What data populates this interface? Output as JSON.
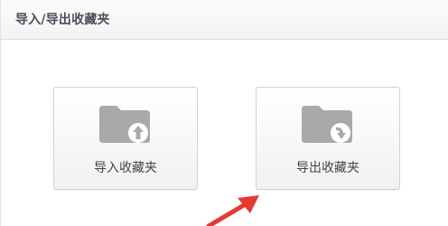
{
  "dialog": {
    "title": "导入/导出收藏夹"
  },
  "options": {
    "import_label": "导入收藏夹",
    "export_label": "导出收藏夹"
  },
  "colors": {
    "folder": "#a9a9a9",
    "annotation_arrow": "#e53935"
  }
}
